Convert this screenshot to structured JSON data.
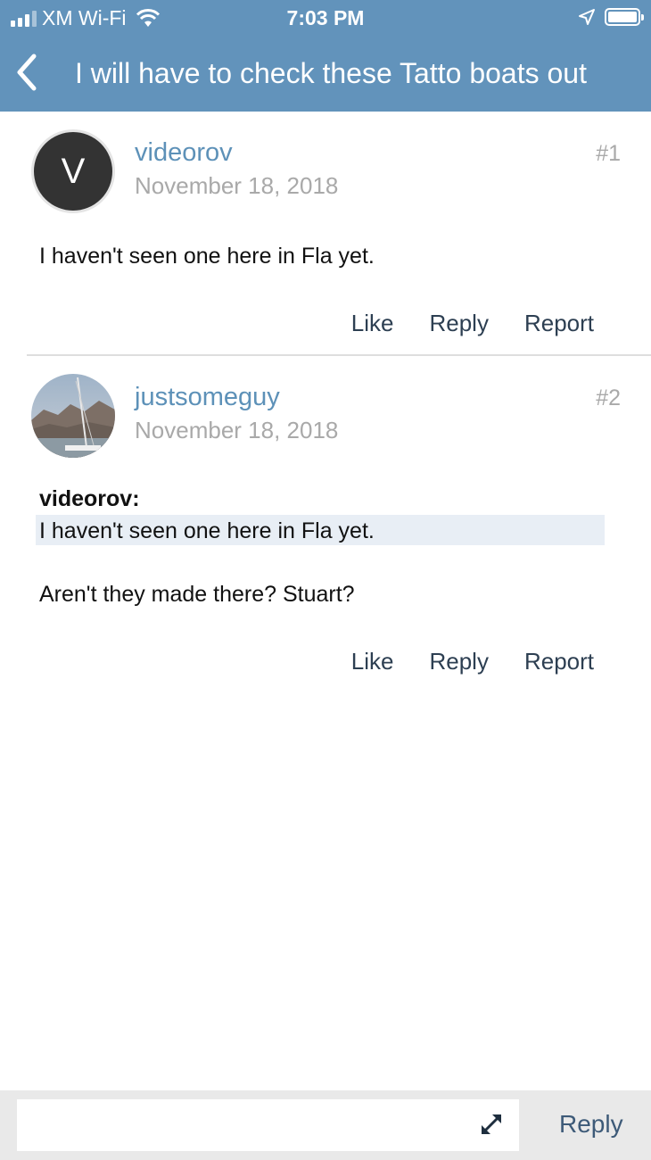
{
  "status_bar": {
    "carrier": "XM Wi-Fi",
    "time": "7:03 PM"
  },
  "nav": {
    "title": "I will have to check these Tatto boats out"
  },
  "posts": [
    {
      "avatar_letter": "V",
      "username": "videorov",
      "date": "November 18, 2018",
      "number": "#1",
      "text": "I haven't seen one here in Fla yet.",
      "actions": {
        "like": "Like",
        "reply": "Reply",
        "report": "Report"
      }
    },
    {
      "username": "justsomeguy",
      "date": "November 18, 2018",
      "number": "#2",
      "quote": {
        "author": "videorov:",
        "text": "I haven't seen one here in Fla yet."
      },
      "text": "Aren't they made there? Stuart?",
      "actions": {
        "like": "Like",
        "reply": "Reply",
        "report": "Report"
      }
    }
  ],
  "reply_bar": {
    "placeholder": "",
    "button": "Reply"
  },
  "colors": {
    "header": "#6293bb",
    "username": "#5d91b8",
    "quote_bg": "#e8eef5"
  }
}
